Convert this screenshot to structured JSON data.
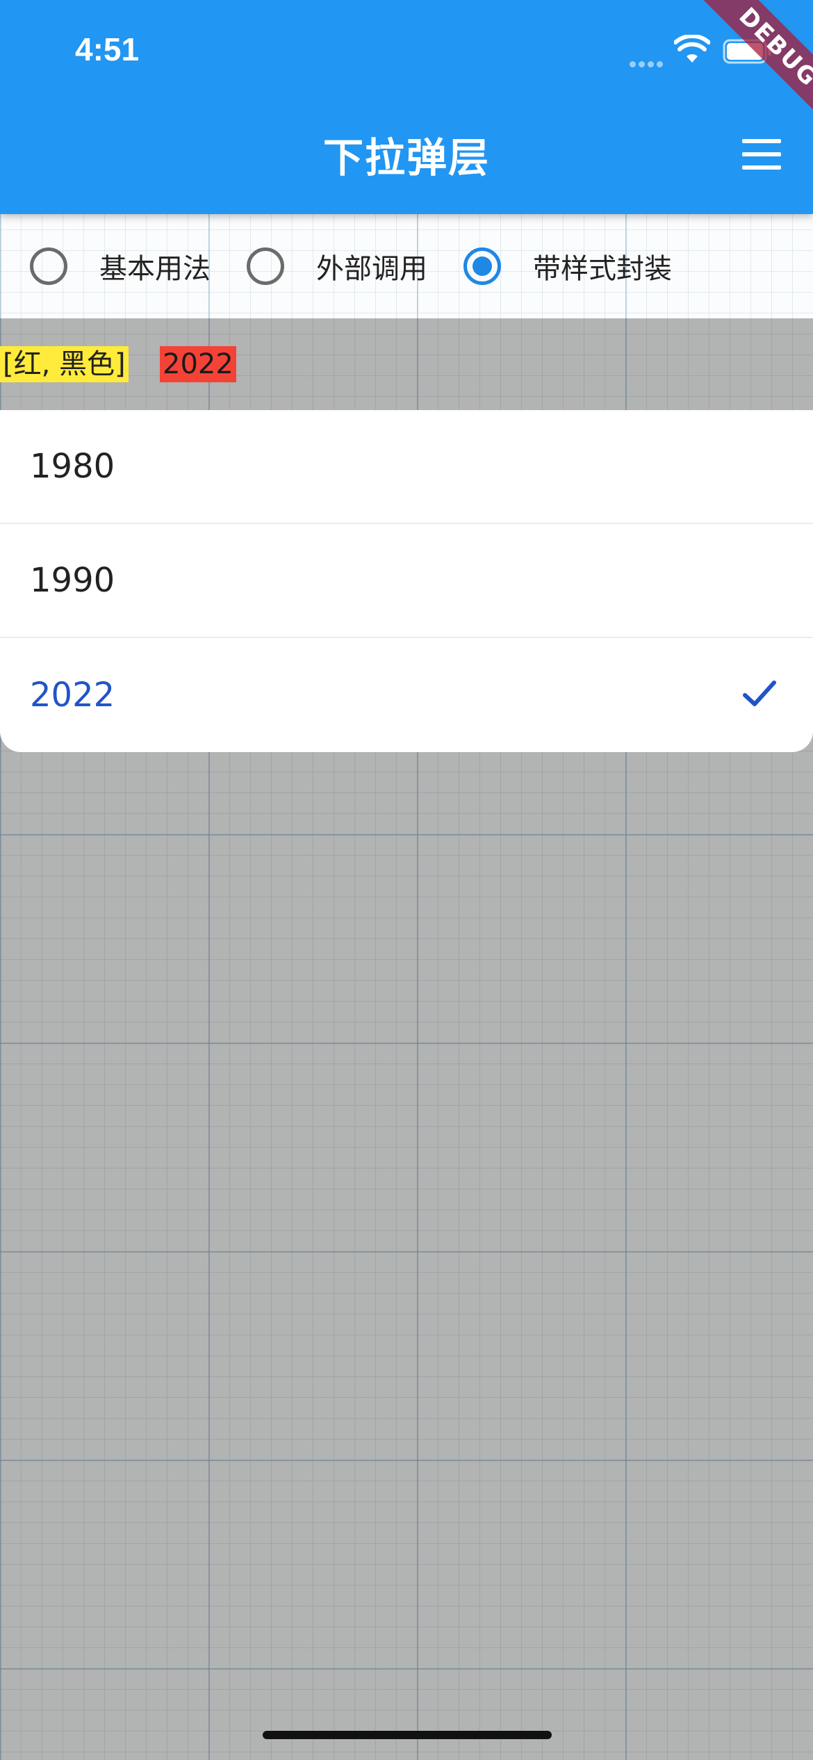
{
  "status_bar": {
    "time": "4:51"
  },
  "app_bar": {
    "title": "下拉弹层",
    "menu_icon": "hamburger-menu-icon"
  },
  "debug_banner": "DEBUG",
  "radio_group": {
    "options": [
      {
        "label": "基本用法",
        "checked": false
      },
      {
        "label": "外部调用",
        "checked": false
      },
      {
        "label": "带样式封装",
        "checked": true
      }
    ]
  },
  "chips": {
    "colors": "[红, 黑色]",
    "year": "2022"
  },
  "dropdown": {
    "options": [
      {
        "label": "1980",
        "selected": false
      },
      {
        "label": "1990",
        "selected": false
      },
      {
        "label": "2022",
        "selected": true
      }
    ],
    "selected_icon": "check-icon"
  },
  "colors": {
    "app_bar": "#2196f3",
    "radio_checked": "#1e88e5",
    "selected_text": "#2254c8",
    "chip_colors_bg": "#ffeb3b",
    "chip_year_bg": "#f44336"
  }
}
